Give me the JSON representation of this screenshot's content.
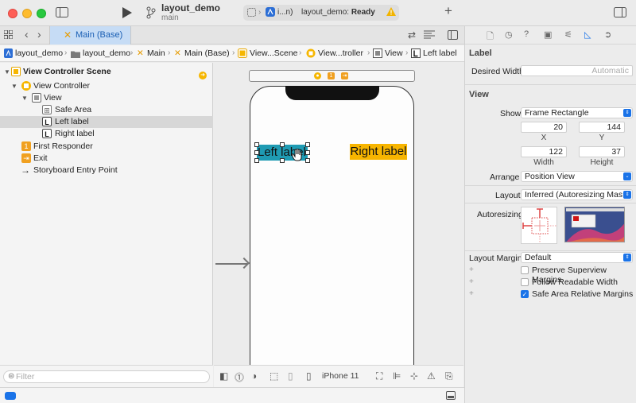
{
  "toolbar": {
    "project_title": "layout_demo",
    "branch": "main",
    "scheme_short": "i...n)",
    "status_name": "layout_demo: ",
    "status_state": "Ready"
  },
  "tabbar": {
    "active_tab": "Main (Base)"
  },
  "jumpbar": {
    "crumbs": [
      "layout_demo",
      "layout_demo",
      "Main",
      "Main (Base)",
      "View...Scene",
      "View...troller",
      "View",
      "Left label"
    ]
  },
  "navigator": {
    "items": [
      {
        "label": "View Controller Scene"
      },
      {
        "label": "View Controller"
      },
      {
        "label": "View"
      },
      {
        "label": "Safe Area"
      },
      {
        "label": "Left label"
      },
      {
        "label": "Right label"
      },
      {
        "label": "First Responder"
      },
      {
        "label": "Exit"
      },
      {
        "label": "Storyboard Entry Point"
      }
    ],
    "filter_placeholder": "Filter"
  },
  "canvas": {
    "left_label_text": "Left label",
    "right_label_text": "Right label",
    "device": "iPhone 11"
  },
  "inspector": {
    "section_label": "Label",
    "desired_width_label": "Desired Width",
    "desired_width_value": "Automatic",
    "section_view": "View",
    "show_label": "Show",
    "show_value": "Frame Rectangle",
    "x_value": "20",
    "y_value": "144",
    "x_label": "X",
    "y_label": "Y",
    "width_value": "122",
    "height_value": "37",
    "width_label": "Width",
    "height_label": "Height",
    "arrange_label": "Arrange",
    "arrange_value": "Position View",
    "layout_label": "Layout",
    "layout_value": "Inferred (Autoresizing Mas...",
    "autoresizing_label": "Autoresizing",
    "layout_margins_label": "Layout Margins",
    "layout_margins_value": "Default",
    "checkboxes": [
      {
        "label": "Preserve Superview Margins",
        "checked": false
      },
      {
        "label": "Follow Readable Width",
        "checked": false
      },
      {
        "label": "Safe Area Relative Margins",
        "checked": true
      }
    ]
  },
  "colors": {
    "accent": "#1a73e8",
    "left_label_bg": "#1f9bb3",
    "right_label_bg": "#f7b500"
  }
}
